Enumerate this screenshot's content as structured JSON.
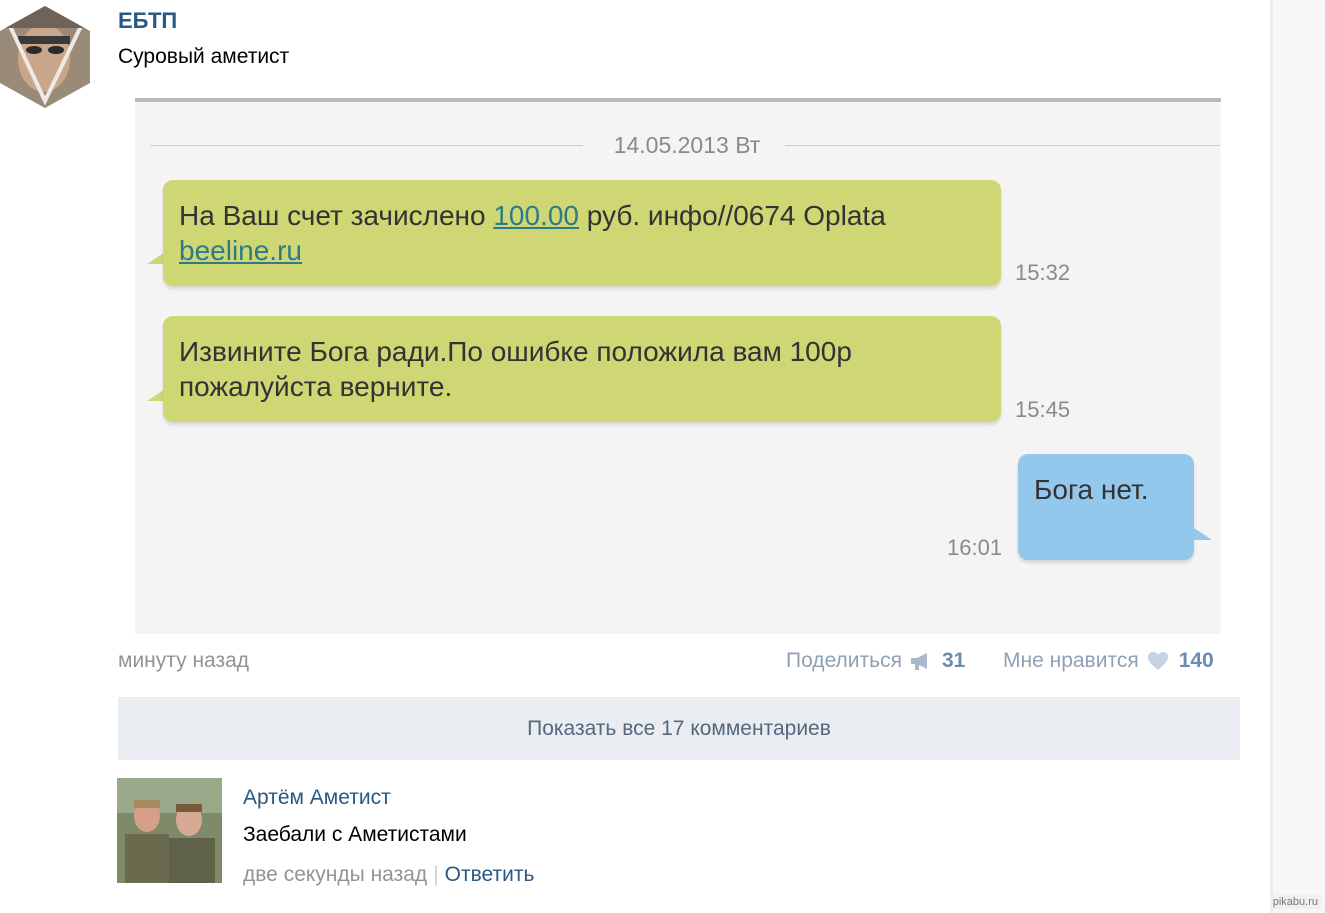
{
  "post": {
    "author": "ЕБТП",
    "text": "Суровый аметист",
    "time": "минуту назад",
    "share_label": "Поделиться",
    "share_count": "31",
    "like_label": "Мне нравится",
    "like_count": "140"
  },
  "sms": {
    "date": "14.05.2013 Вт",
    "messages": [
      {
        "direction": "incoming",
        "text_before_link": "На Ваш счет зачислено ",
        "link1": "100.00",
        "text_mid": " руб. инфо//0674 Oplata ",
        "link2": "beeline.ru",
        "time": "15:32"
      },
      {
        "direction": "incoming",
        "text": "Извините Бога ради.По ошибке положила вам 100р пожалуйста верните.",
        "time": "15:45"
      },
      {
        "direction": "outgoing",
        "text": "Бога нет.",
        "time": "16:01"
      }
    ]
  },
  "comments": {
    "show_all_label": "Показать все 17 комментариев",
    "items": [
      {
        "author": "Артём Аметист",
        "text": "Заебали с Аметистами",
        "time": "две секунды назад",
        "reply_label": "Ответить"
      }
    ]
  },
  "watermark": "pikabu.ru"
}
